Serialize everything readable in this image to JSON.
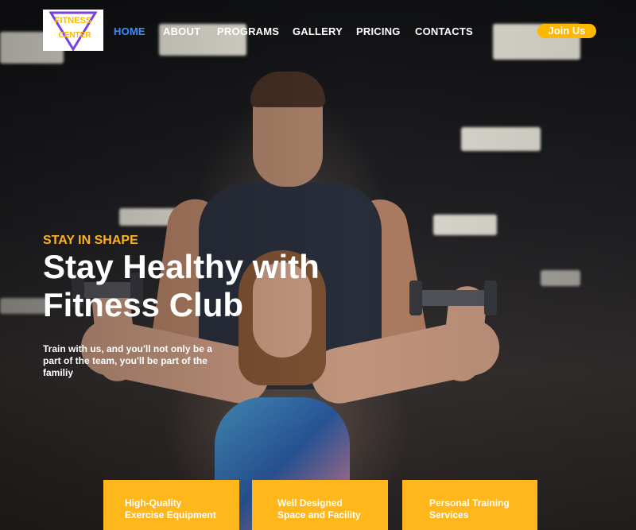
{
  "logo": {
    "line1": "FITNESS",
    "line2": "CENTER",
    "colors": {
      "triangle": "#7b3fe4",
      "text": "#ffb800"
    }
  },
  "nav": {
    "items": [
      {
        "label": "HOME",
        "active": true
      },
      {
        "label": "ABOUT",
        "active": false
      },
      {
        "label": "PROGRAMS",
        "active": false
      },
      {
        "label": "GALLERY",
        "active": false
      },
      {
        "label": "PRICING",
        "active": false
      },
      {
        "label": "CONTACTS",
        "active": false
      }
    ],
    "join_label": "Join Us"
  },
  "hero": {
    "eyebrow": "STAY IN SHAPE",
    "headline_line1": "Stay Healthy with",
    "headline_line2": "Fitness Club",
    "subtext_line1": "Train with us, and you'll not only be a",
    "subtext_line2": "part of the team, you'll be  part of the",
    "subtext_line3": "familiy"
  },
  "features": [
    {
      "line1": "High-Quality",
      "line2": "Exercise Equipment"
    },
    {
      "line1": "Well Designed",
      "line2": "Space and Facility"
    },
    {
      "line1": "Personal Training",
      "line2": "Services"
    }
  ],
  "colors": {
    "accent": "#ffb71b",
    "nav_active": "#3d8bff",
    "text": "#ffffff"
  }
}
